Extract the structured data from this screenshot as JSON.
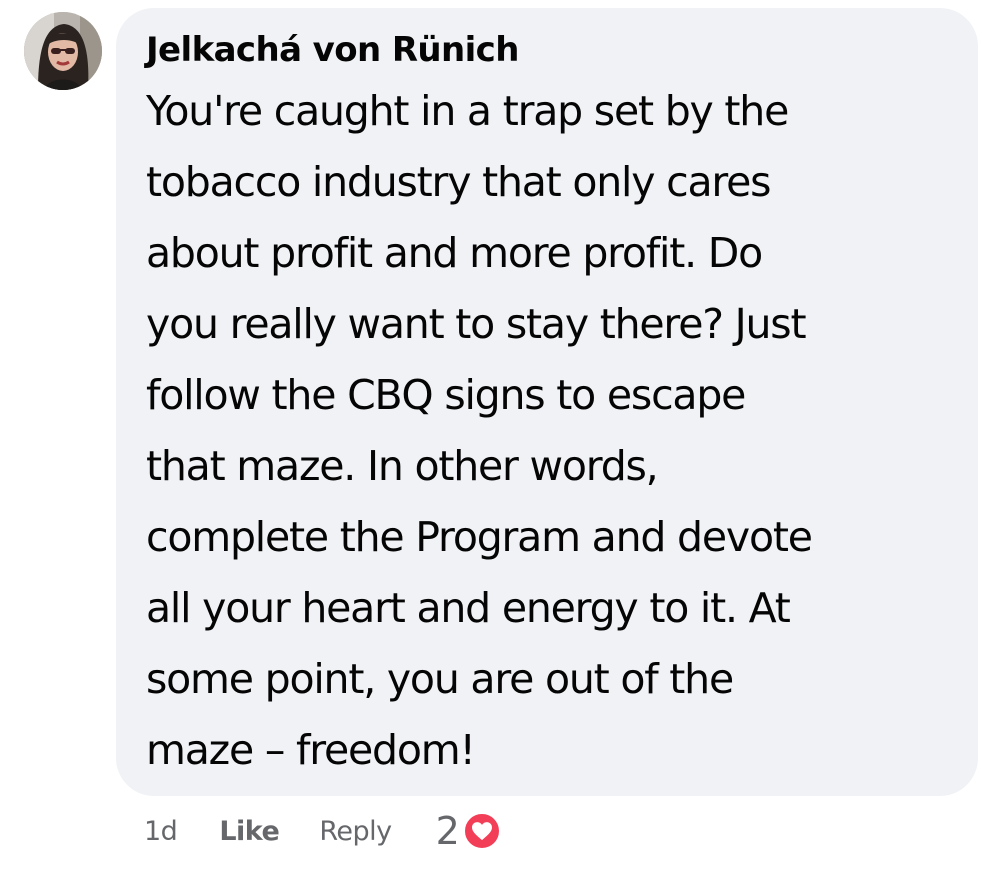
{
  "comment": {
    "author": "Jelkachá von Rünich",
    "text": "You're caught in a trap set by the\ntobacco industry that only cares\nabout profit and more profit. Do\nyou really want to stay there? Just\nfollow the CBQ signs to escape\nthat maze. In other words,\ncomplete the Program and devote\nall your heart and energy to it. At\nsome point, you are out of the\nmaze – freedom!",
    "avatar": "profile-photo"
  },
  "actions": {
    "timestamp": "1d",
    "like_label": "Like",
    "reply_label": "Reply",
    "reaction_count": "2",
    "reaction_icon": "heart-icon"
  },
  "colors": {
    "bubble_background": "#f0f2f5",
    "text": "#050505",
    "secondary_text": "#65676b",
    "heart": "#f33e58"
  }
}
